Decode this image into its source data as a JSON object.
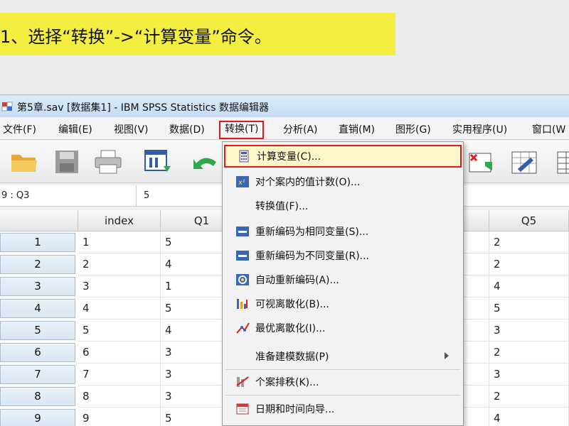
{
  "banner": {
    "text": "1、选择“转换”->“计算变量”命令。",
    "bg": "#f3ee3f"
  },
  "window": {
    "title": "第5章.sav [数据集1] - IBM SPSS Statistics 数据编辑器"
  },
  "menubar": {
    "items": [
      {
        "label": "文件(F)"
      },
      {
        "label": "编辑(E)"
      },
      {
        "label": "视图(V)"
      },
      {
        "label": "数据(D)"
      },
      {
        "label": "转换(T)"
      },
      {
        "label": "分析(A)"
      },
      {
        "label": "直销(M)"
      },
      {
        "label": "图形(G)"
      },
      {
        "label": "实用程序(U)"
      },
      {
        "label": "窗口(W"
      }
    ],
    "active_index": 4,
    "highlight_color": "#e31a1a"
  },
  "toolbar": {
    "icons": [
      "open-folder-icon",
      "save-disk-icon",
      "print-icon",
      "recall-dialog-icon",
      "undo-icon",
      "insert-cases-icon",
      "chart-builder-icon",
      "grid-icon"
    ]
  },
  "cellbar": {
    "ref": "9 : Q3",
    "value": "5"
  },
  "grid": {
    "columns": [
      "index",
      "Q1",
      "Q5"
    ],
    "rows": [
      {
        "n": "1",
        "index": "1",
        "Q1": "5",
        "Q5": "2"
      },
      {
        "n": "2",
        "index": "2",
        "Q1": "4",
        "Q5": "2"
      },
      {
        "n": "3",
        "index": "3",
        "Q1": "1",
        "Q5": "4"
      },
      {
        "n": "4",
        "index": "4",
        "Q1": "5",
        "Q5": "5"
      },
      {
        "n": "5",
        "index": "5",
        "Q1": "4",
        "Q5": "3"
      },
      {
        "n": "6",
        "index": "6",
        "Q1": "3",
        "Q5": "2"
      },
      {
        "n": "7",
        "index": "7",
        "Q1": "3",
        "Q5": "3"
      },
      {
        "n": "8",
        "index": "8",
        "Q1": "3",
        "Q5": "2"
      },
      {
        "n": "9",
        "index": "9",
        "Q1": "5",
        "Q5": "4"
      }
    ]
  },
  "dropdown": {
    "items": [
      {
        "label": "计算变量(C)...",
        "icon": "calculator-icon",
        "highlight": true
      },
      {
        "label": "对个案内的值计数(O)...",
        "icon": "count-values-icon"
      },
      {
        "label": "转换值(F)...",
        "icon": ""
      },
      {
        "label": "重新编码为相同变量(S)...",
        "icon": "recode-same-icon"
      },
      {
        "label": "重新编码为不同变量(R)...",
        "icon": "recode-different-icon"
      },
      {
        "label": "自动重新编码(A)...",
        "icon": "automatic-recode-icon"
      },
      {
        "label": "可视离散化(B)...",
        "icon": "visual-binning-icon"
      },
      {
        "label": "最优离散化(I)...",
        "icon": "optimal-binning-icon"
      },
      {
        "label": "准备建模数据(P)",
        "icon": "",
        "submenu": true
      },
      {
        "label": "个案排秩(K)...",
        "icon": "rank-cases-icon"
      },
      {
        "label": "日期和时间向导...",
        "icon": "calendar-icon"
      }
    ]
  }
}
